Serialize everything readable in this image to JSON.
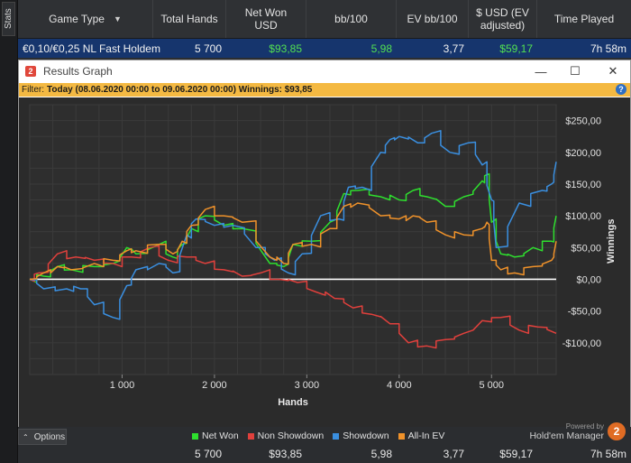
{
  "stats_tab": "Stats",
  "header": {
    "columns": [
      "Game Type",
      "Total Hands",
      "Net Won\nUSD",
      "bb/100",
      "EV bb/100",
      "$ USD (EV\nadjusted)",
      "Time Played"
    ]
  },
  "row": {
    "game_type": "€0,10/€0,25 NL Fast Holdem",
    "total_hands": "5 700",
    "net_won": "$93,85",
    "bb100": "5,98",
    "ev_bb100": "3,77",
    "usd_ev": "$59,17",
    "time_played": "7h 58m"
  },
  "window": {
    "title": "Results Graph",
    "logo": "2",
    "minimize": "—",
    "maximize": "☐",
    "close": "✕"
  },
  "filter": {
    "label": "Filter:",
    "text": "Today (08.06.2020 00:00 to 09.06.2020 00:00)  Winnings: $93,85",
    "help": "?"
  },
  "options_label": "Options",
  "brand": {
    "small": "Powered by",
    "big": "Hold'em Manager",
    "logo": "2"
  },
  "footer": {
    "total_hands": "5 700",
    "net_won": "$93,85",
    "bb100": "5,98",
    "ev_bb100": "3,77",
    "usd_ev": "$59,17",
    "time_played": "7h 58m"
  },
  "colors": {
    "net_won": "#2ee02e",
    "non_showdown": "#e0403c",
    "showdown": "#3a8fe0",
    "allin_ev": "#f0922a"
  },
  "chart_data": {
    "type": "line",
    "xlabel": "Hands",
    "ylabel": "Winnings",
    "xlim": [
      0,
      5700
    ],
    "ylim": [
      -150,
      275
    ],
    "x_ticks": [
      1000,
      2000,
      3000,
      4000,
      5000
    ],
    "x_tick_labels": [
      "1 000",
      "2 000",
      "3 000",
      "4 000",
      "5 000"
    ],
    "y_ticks": [
      -100,
      -50,
      0,
      50,
      100,
      150,
      200,
      250
    ],
    "y_tick_labels": [
      "-$100,00",
      "-$50,00",
      "$0,00",
      "$50,00",
      "$100,00",
      "$150,00",
      "$200,00",
      "$250,00"
    ],
    "grid": true,
    "legend_position": "bottom",
    "series": [
      {
        "name": "Net Won",
        "x": [
          0,
          150,
          300,
          450,
          700,
          900,
          1050,
          1150,
          1400,
          1550,
          1650,
          1750,
          1900,
          2100,
          2300,
          2600,
          2750,
          2850,
          3050,
          3250,
          3400,
          3550,
          3800,
          4000,
          4150,
          4300,
          4500,
          4700,
          4900,
          4950,
          5000,
          5100,
          5250,
          5450,
          5650,
          5700
        ],
        "values": [
          0,
          5,
          20,
          15,
          20,
          25,
          50,
          40,
          55,
          35,
          55,
          80,
          100,
          85,
          80,
          25,
          20,
          55,
          60,
          90,
          135,
          140,
          130,
          125,
          140,
          130,
          115,
          130,
          155,
          165,
          90,
          40,
          35,
          50,
          60,
          100
        ]
      },
      {
        "name": "Non Showdown",
        "x": [
          0,
          100,
          300,
          500,
          700,
          900,
          1100,
          1300,
          1500,
          1700,
          1900,
          2100,
          2300,
          2500,
          2700,
          2900,
          3100,
          3300,
          3500,
          3700,
          3900,
          4100,
          4300,
          4500,
          4700,
          4900,
          5100,
          5300,
          5500,
          5700
        ],
        "values": [
          0,
          10,
          40,
          35,
          30,
          25,
          35,
          50,
          30,
          35,
          25,
          15,
          5,
          10,
          0,
          -5,
          -20,
          -30,
          -45,
          -55,
          -70,
          -100,
          -105,
          -95,
          -85,
          -65,
          -60,
          -80,
          -75,
          -85
        ]
      },
      {
        "name": "Showdown",
        "x": [
          0,
          150,
          400,
          550,
          700,
          900,
          1050,
          1150,
          1400,
          1550,
          1700,
          1800,
          2000,
          2200,
          2450,
          2650,
          2800,
          2950,
          3150,
          3350,
          3450,
          3600,
          3800,
          3900,
          4000,
          4200,
          4350,
          4550,
          4750,
          4900,
          5000,
          5050,
          5300,
          5550,
          5650,
          5700
        ],
        "values": [
          0,
          -15,
          -15,
          -15,
          -40,
          -60,
          -10,
          15,
          25,
          10,
          70,
          95,
          85,
          85,
          50,
          30,
          10,
          40,
          100,
          95,
          145,
          145,
          200,
          220,
          225,
          215,
          230,
          200,
          215,
          180,
          125,
          50,
          120,
          140,
          150,
          185
        ]
      },
      {
        "name": "All-In EV",
        "x": [
          0,
          150,
          300,
          450,
          700,
          900,
          1050,
          1150,
          1400,
          1550,
          1650,
          1750,
          1900,
          2100,
          2300,
          2600,
          2750,
          2850,
          3050,
          3250,
          3400,
          3550,
          3800,
          4000,
          4150,
          4300,
          4500,
          4700,
          4900,
          4950,
          5000,
          5100,
          5250,
          5450,
          5650,
          5700
        ],
        "values": [
          0,
          10,
          20,
          15,
          25,
          30,
          45,
          45,
          55,
          40,
          60,
          85,
          110,
          100,
          90,
          35,
          25,
          55,
          55,
          80,
          115,
          120,
          100,
          95,
          100,
          90,
          70,
          70,
          80,
          90,
          30,
          15,
          10,
          20,
          30,
          60
        ]
      }
    ]
  }
}
